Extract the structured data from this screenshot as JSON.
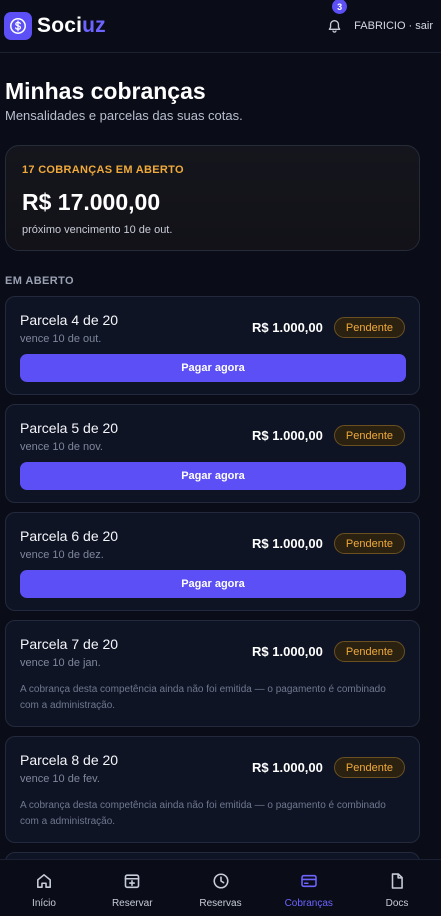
{
  "header": {
    "brand_prefix": "Soci",
    "brand_suffix": "uz",
    "brand_icon": "dollar-sign-icon",
    "notification_count": "3",
    "user_label": "FABRICIO · sair"
  },
  "page": {
    "title": "Minhas cobranças",
    "subtitle": "Mensalidades e parcelas das suas cotas."
  },
  "summary": {
    "kicker": "17 COBRANÇAS EM ABERTO",
    "amount": "R$ 17.000,00",
    "next_due": "próximo vencimento 10 de out."
  },
  "section_label": "EM ABERTO",
  "installments": [
    {
      "title": "Parcela 4 de 20",
      "due": "vence 10 de out.",
      "amount": "R$ 1.000,00",
      "status": "Pendente",
      "action": "Pagar agora",
      "note": ""
    },
    {
      "title": "Parcela 5 de 20",
      "due": "vence 10 de nov.",
      "amount": "R$ 1.000,00",
      "status": "Pendente",
      "action": "Pagar agora",
      "note": ""
    },
    {
      "title": "Parcela 6 de 20",
      "due": "vence 10 de dez.",
      "amount": "R$ 1.000,00",
      "status": "Pendente",
      "action": "Pagar agora",
      "note": ""
    },
    {
      "title": "Parcela 7 de 20",
      "due": "vence 10 de jan.",
      "amount": "R$ 1.000,00",
      "status": "Pendente",
      "action": "",
      "note": "A cobrança desta competência ainda não foi emitida — o pagamento é combinado com a administração."
    },
    {
      "title": "Parcela 8 de 20",
      "due": "vence 10 de fev.",
      "amount": "R$ 1.000,00",
      "status": "Pendente",
      "action": "",
      "note": "A cobrança desta competência ainda não foi emitida — o pagamento é combinado com a administração."
    },
    {
      "title": "",
      "due": "",
      "amount": "",
      "status": "",
      "action": "",
      "note": ""
    }
  ],
  "nav": [
    {
      "label": "Início",
      "icon": "home-icon",
      "active": false
    },
    {
      "label": "Reservar",
      "icon": "calendar-plus-icon",
      "active": false
    },
    {
      "label": "Reservas",
      "icon": "clock-icon",
      "active": false
    },
    {
      "label": "Cobranças",
      "icon": "credit-card-icon",
      "active": true
    },
    {
      "label": "Docs",
      "icon": "document-icon",
      "active": false
    }
  ],
  "colors": {
    "accent": "#5b4ff5",
    "accent_text": "#6d63ff",
    "warning": "#f0a93a",
    "background": "#0a0d18",
    "card": "#0f1424"
  }
}
